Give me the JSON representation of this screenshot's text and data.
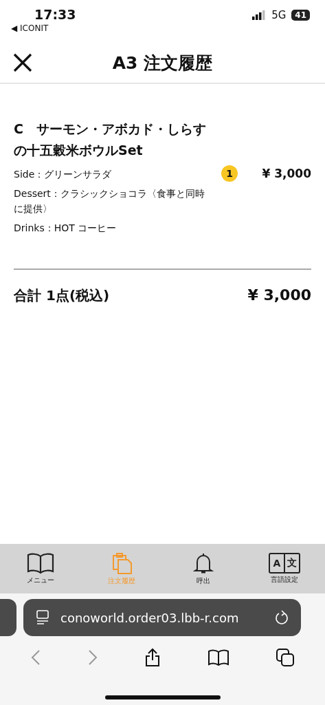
{
  "status_bar": {
    "time": "17:33",
    "back_app": "◀ ICONIT",
    "network": "5G",
    "battery": "41"
  },
  "header": {
    "title": "A3 注文履歴"
  },
  "orders": [
    {
      "name": "C　サーモン・アボカド・しらすの十五穀米ボウルSet",
      "options": [
        "Side：グリーンサラダ",
        "Dessert：クラシックショコラ〈食事と同時に提供〉",
        "Drinks：HOT コーヒー"
      ],
      "quantity": "1",
      "price": "¥ 3,000"
    }
  ],
  "total": {
    "label": "合計 1点(税込)",
    "amount": "¥ 3,000"
  },
  "bottom_nav": [
    {
      "kind": "book",
      "label": "メニュー",
      "selected": false
    },
    {
      "kind": "clipboard",
      "label": "注文履歴",
      "selected": true
    },
    {
      "kind": "bell",
      "label": "呼出",
      "selected": false
    },
    {
      "kind": "language",
      "label": "言語設定",
      "selected": false,
      "icon_text": [
        "A",
        "文"
      ]
    }
  ],
  "browser": {
    "url": "conoworld.order03.lbb-r.com"
  }
}
